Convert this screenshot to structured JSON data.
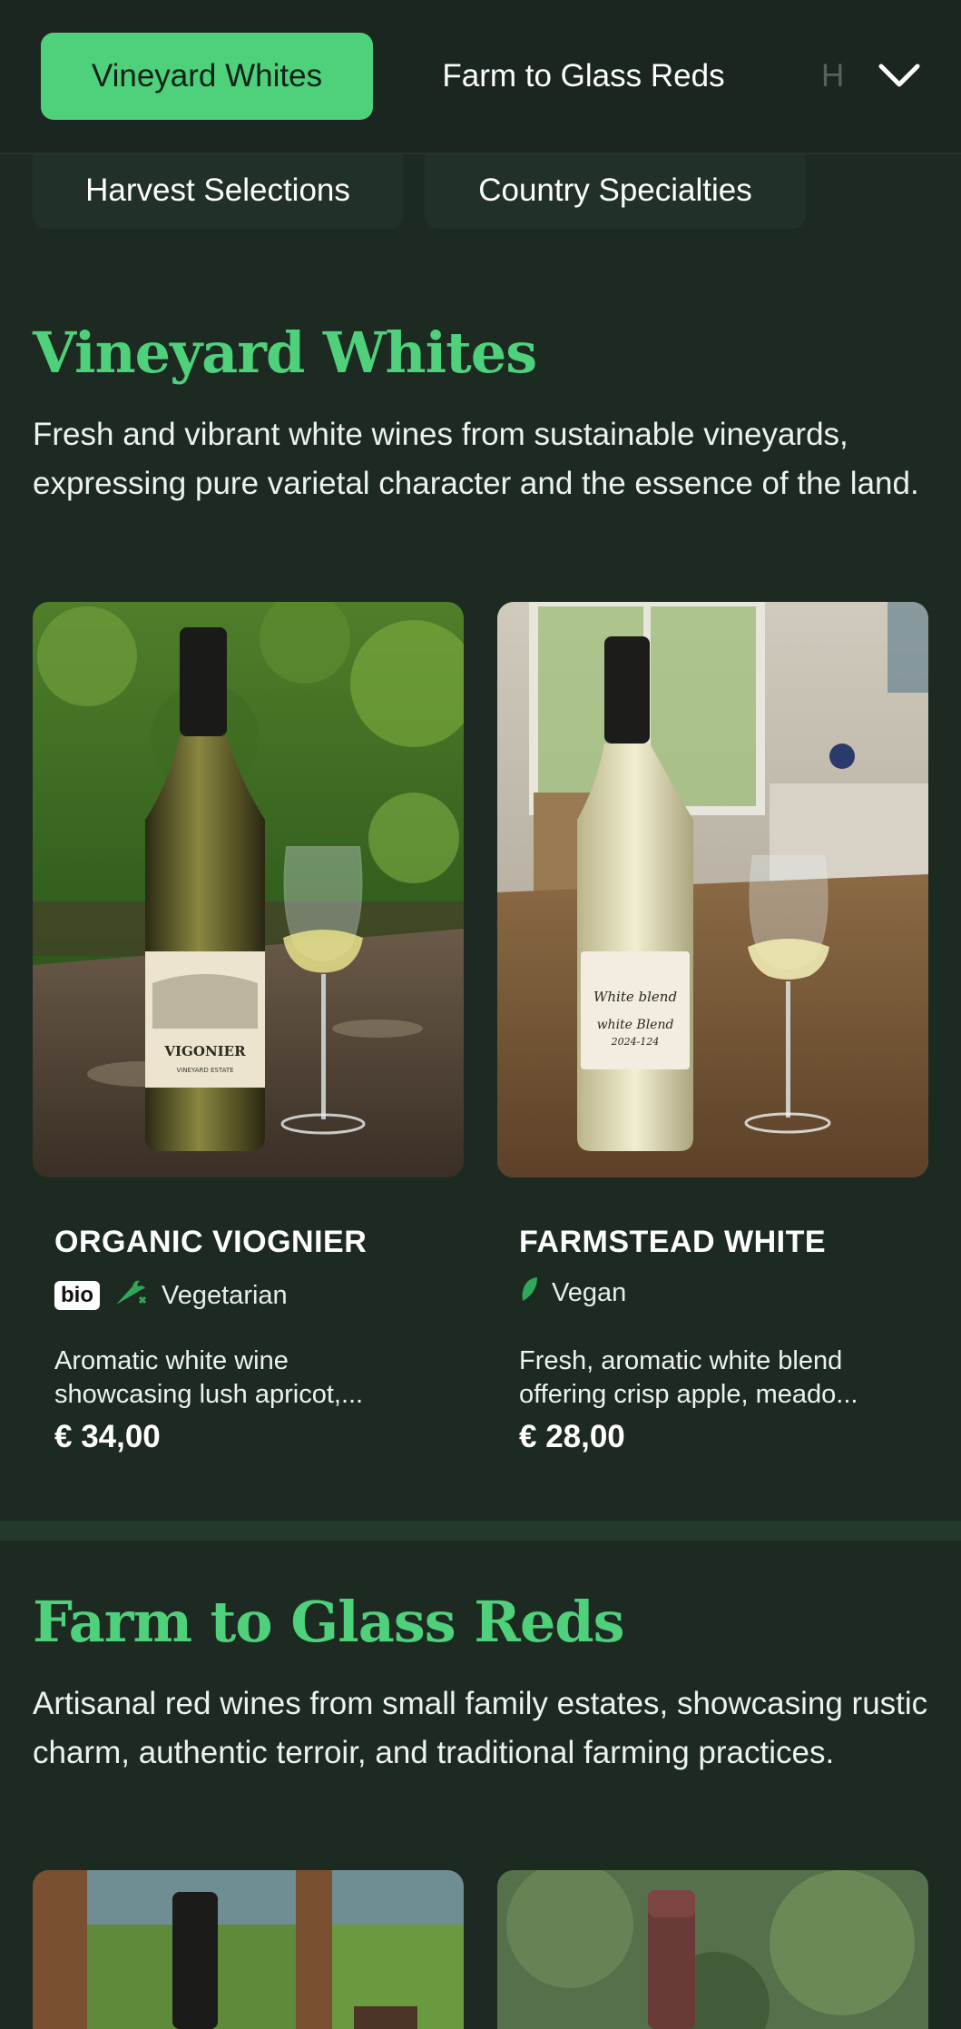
{
  "nav": {
    "pills": [
      {
        "label": "Vineyard Whites",
        "active": true
      },
      {
        "label": "Farm to Glass Reds",
        "active": false
      },
      {
        "label": "H",
        "active": false
      },
      {
        "label": "Harvest Selections",
        "active": false
      },
      {
        "label": "Country Specialties",
        "active": false
      }
    ],
    "expand_icon": "chevron-down-icon"
  },
  "sections": [
    {
      "title": "Vineyard Whites",
      "description": "Fresh and vibrant white wines from sustainable vineyards, expressing pure varietal character and the essence of the land.",
      "products": [
        {
          "name": "ORGANIC VIOGNIER",
          "badges": {
            "bio": "bio",
            "diet": "Vegetarian"
          },
          "diet_icon": "carrot-icon",
          "desc_line1": "Aromatic white wine",
          "desc_line2": "showcasing lush apricot,...",
          "price": "€ 34,00",
          "label_text": "VIGONIER",
          "label_sub": "VINEYARD ESTATE"
        },
        {
          "name": "FARMSTEAD WHITE",
          "badges": {
            "diet": "Vegan"
          },
          "diet_icon": "leaf-icon",
          "desc_line1": "Fresh, aromatic white blend",
          "desc_line2": "offering crisp apple, meado...",
          "price": "€ 28,00",
          "label_text": "White blend",
          "label_sub": "white Blend",
          "label_year": "2024-124"
        }
      ]
    },
    {
      "title": "Farm to Glass Reds",
      "description": "Artisanal red wines from small family estates, showcasing rustic charm, authentic terroir, and traditional farming practices."
    }
  ],
  "colors": {
    "accent": "#4fd07a",
    "background": "#1c2a22",
    "nav_bg": "#1b2620"
  }
}
